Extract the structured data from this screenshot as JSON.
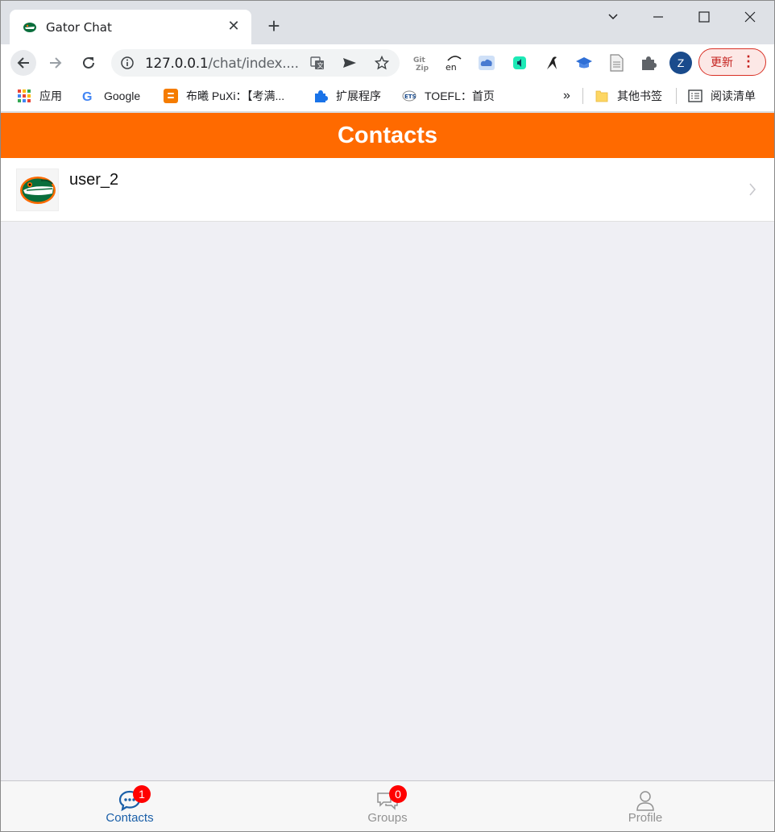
{
  "browser": {
    "tab_title": "Gator Chat",
    "url_host": "127.0.0.1",
    "url_path": "/chat/index....",
    "update_label": "更新",
    "profile_initial": "Z"
  },
  "bookmarks": {
    "apps": "应用",
    "google": "Google",
    "puxi": "布曦 PuXi：【考满...",
    "extensions": "扩展程序",
    "toefl": "TOEFL：首页",
    "more": "»",
    "other": "其他书签",
    "reading_list": "阅读清单"
  },
  "app": {
    "header_title": "Contacts",
    "accent_color": "#ff6a00",
    "contacts": [
      {
        "name": "user_2",
        "avatar": "gator-logo"
      }
    ],
    "tabbar": {
      "contacts_label": "Contacts",
      "contacts_badge": "1",
      "groups_label": "Groups",
      "groups_badge": "0",
      "profile_label": "Profile",
      "active_color": "#1a5fa8",
      "inactive_color": "#929292"
    }
  }
}
